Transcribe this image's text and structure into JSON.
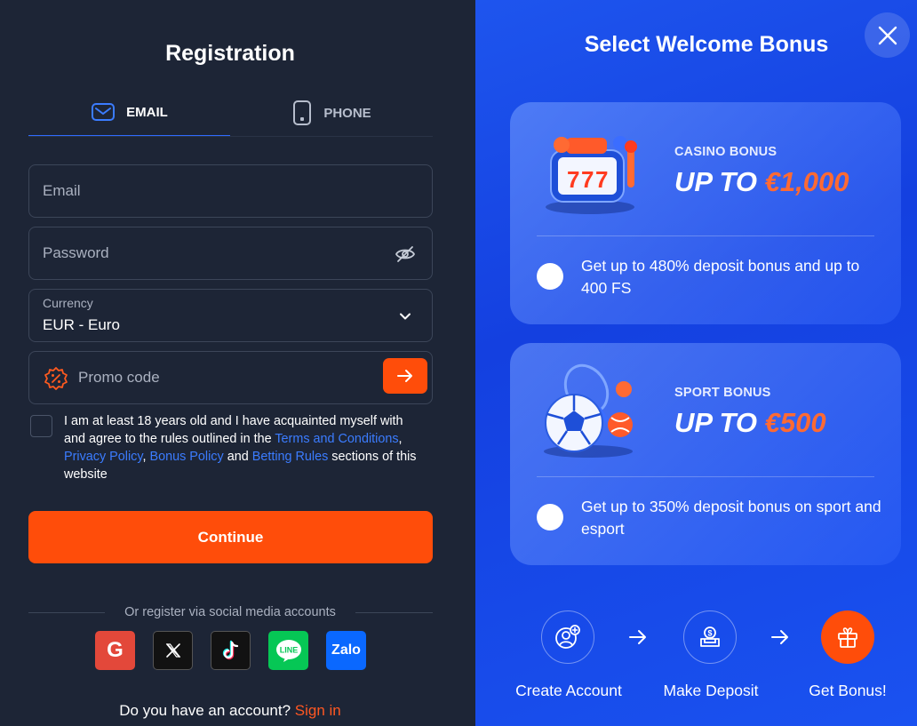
{
  "registration": {
    "title": "Registration",
    "tabs": [
      {
        "label": "EMAIL",
        "icon": "envelope-icon",
        "active": true
      },
      {
        "label": "PHONE",
        "icon": "phone-icon",
        "active": false
      }
    ],
    "email_placeholder": "Email",
    "password_placeholder": "Password",
    "currency_label": "Currency",
    "currency_value": "EUR - Euro",
    "promo_placeholder": "Promo code",
    "terms": {
      "text_1": "I am at least 18 years old and I have acquainted myself with and agree to the rules outlined in the ",
      "link_terms": "Terms and Conditions",
      "sep_1": ", ",
      "link_privacy": "Privacy Policy",
      "sep_2": ", ",
      "link_bonus": "Bonus Policy",
      "sep_3": " and ",
      "link_betting": "Betting Rules",
      "text_2": " sections of this website"
    },
    "continue_label": "Continue",
    "social_label": "Or register via social media accounts",
    "social": [
      {
        "name": "Google",
        "glyph": "G"
      },
      {
        "name": "X"
      },
      {
        "name": "TikTok"
      },
      {
        "name": "LINE",
        "glyph": "LINE"
      },
      {
        "name": "Zalo",
        "glyph": "Zalo"
      }
    ],
    "have_account": "Do you have an account?",
    "sign_in": "Sign in"
  },
  "bonus": {
    "title": "Select Welcome Bonus",
    "cards": [
      {
        "label": "CASINO BONUS",
        "amount_prefix": "UP TO ",
        "amount": "€1,000",
        "description": "Get up to 480% deposit bonus and up to 400 FS",
        "image": "slot-machine-777-illustration"
      },
      {
        "label": "SPORT BONUS",
        "amount_prefix": "UP TO ",
        "amount": "€500",
        "description": "Get up to 350% deposit bonus on sport and esport",
        "image": "soccer-ball-tennis-racket-illustration"
      }
    ],
    "steps": [
      {
        "label": "Create Account",
        "icon": "add-user-icon"
      },
      {
        "label": "Make Deposit",
        "icon": "deposit-icon"
      },
      {
        "label": "Get Bonus!",
        "icon": "gift-icon"
      }
    ]
  },
  "colors": {
    "accent_orange": "#ff4d0a",
    "link_blue": "#3b7cff",
    "panel_dark": "#1d2536",
    "panel_blue": "#1a4ef0"
  }
}
